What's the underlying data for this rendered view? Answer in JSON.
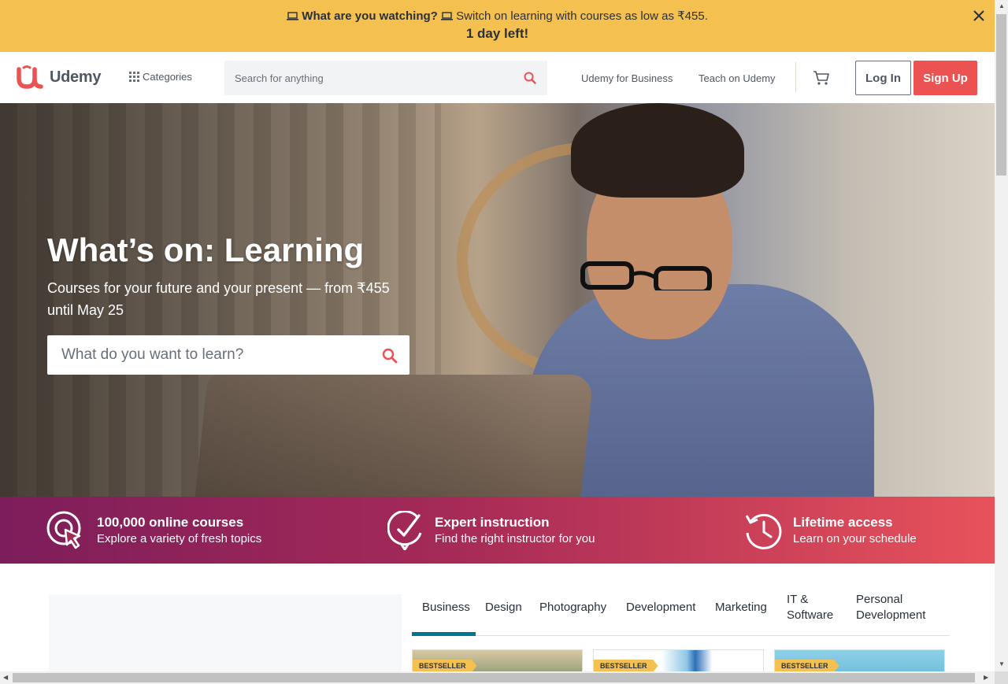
{
  "promo": {
    "headline": "What are you watching?",
    "text": "Switch on learning with courses as low as ₹455.",
    "countdown": "1 day left!"
  },
  "header": {
    "logo_text": "Udemy",
    "categories_label": "Categories",
    "search_placeholder": "Search for anything",
    "business_link": "Udemy for Business",
    "teach_link": "Teach on Udemy",
    "login_label": "Log In",
    "signup_label": "Sign Up"
  },
  "hero": {
    "title": "What’s on: Learning",
    "subtitle": "Courses for your future and your present — from ₹455 until May 25",
    "search_placeholder": "What do you want to learn?"
  },
  "features": [
    {
      "title": "100,000 online courses",
      "desc": "Explore a variety of fresh topics",
      "icon": "cursor-target-icon"
    },
    {
      "title": "Expert instruction",
      "desc": "Find the right instructor for you",
      "icon": "check-badge-icon"
    },
    {
      "title": "Lifetime access",
      "desc": "Learn on your schedule",
      "icon": "clock-history-icon"
    }
  ],
  "tabs": [
    {
      "label": "Business",
      "active": true
    },
    {
      "label": "Design"
    },
    {
      "label": "Photography"
    },
    {
      "label": "Development"
    },
    {
      "label": "Marketing"
    },
    {
      "label": "IT & Software"
    },
    {
      "label": "Personal Development"
    }
  ],
  "cards": [
    {
      "badge": "BESTSELLER"
    },
    {
      "badge": "BESTSELLER"
    },
    {
      "badge": "BESTSELLER"
    }
  ],
  "colors": {
    "promo_bg": "#f4c150",
    "brand_red": "#ec5252",
    "tab_active": "#007791",
    "feature_gradient_start": "#7d1d5b",
    "feature_gradient_end": "#e8525a"
  }
}
